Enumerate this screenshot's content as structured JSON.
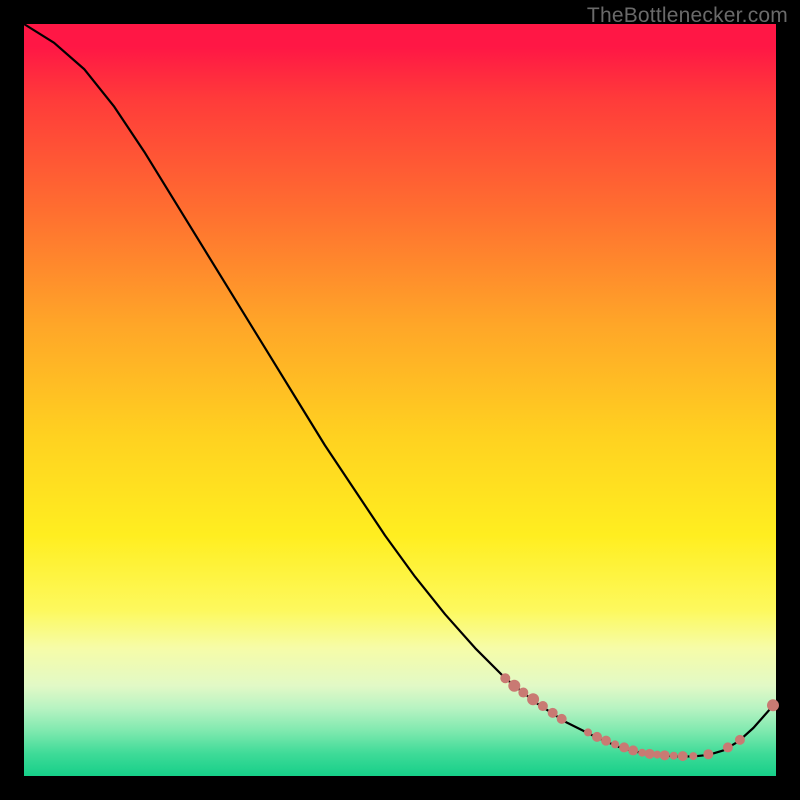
{
  "watermark": "TheBottlenecker.com",
  "colors": {
    "page_bg": "#000000",
    "curve_stroke": "#000000",
    "marker_fill": "#c97a73",
    "marker_stroke": "#c97a73"
  },
  "chart_data": {
    "type": "line",
    "title": "",
    "xlabel": "",
    "ylabel": "",
    "xlim": [
      0,
      100
    ],
    "ylim": [
      0,
      100
    ],
    "grid": false,
    "legend": false,
    "series": [
      {
        "name": "curve",
        "x": [
          0,
          4,
          8,
          12,
          16,
          20,
          24,
          28,
          32,
          36,
          40,
          44,
          48,
          52,
          56,
          60,
          64,
          68,
          72,
          76,
          79,
          81,
          83,
          85,
          87,
          89,
          91,
          93,
          95,
          97,
          100
        ],
        "y": [
          100,
          97.5,
          94,
          89,
          83,
          76.5,
          70,
          63.5,
          57,
          50.5,
          44,
          38,
          32,
          26.5,
          21.5,
          17,
          13,
          9.8,
          7.2,
          5.2,
          3.9,
          3.3,
          2.9,
          2.7,
          2.6,
          2.6,
          2.8,
          3.4,
          4.6,
          6.4,
          9.8
        ]
      }
    ],
    "markers": [
      {
        "x": 64.0,
        "y": 13.0,
        "r": 5
      },
      {
        "x": 65.2,
        "y": 12.0,
        "r": 6
      },
      {
        "x": 66.4,
        "y": 11.1,
        "r": 5
      },
      {
        "x": 67.7,
        "y": 10.2,
        "r": 6
      },
      {
        "x": 69.0,
        "y": 9.3,
        "r": 5
      },
      {
        "x": 70.3,
        "y": 8.4,
        "r": 5
      },
      {
        "x": 71.5,
        "y": 7.6,
        "r": 5
      },
      {
        "x": 75.0,
        "y": 5.8,
        "r": 4
      },
      {
        "x": 76.2,
        "y": 5.2,
        "r": 5
      },
      {
        "x": 77.4,
        "y": 4.7,
        "r": 5
      },
      {
        "x": 78.6,
        "y": 4.2,
        "r": 4
      },
      {
        "x": 79.8,
        "y": 3.8,
        "r": 5
      },
      {
        "x": 81.0,
        "y": 3.4,
        "r": 5
      },
      {
        "x": 82.2,
        "y": 3.1,
        "r": 4
      },
      {
        "x": 83.2,
        "y": 2.95,
        "r": 5
      },
      {
        "x": 84.2,
        "y": 2.85,
        "r": 4
      },
      {
        "x": 85.2,
        "y": 2.75,
        "r": 5
      },
      {
        "x": 86.4,
        "y": 2.7,
        "r": 4
      },
      {
        "x": 87.6,
        "y": 2.65,
        "r": 5
      },
      {
        "x": 89.0,
        "y": 2.65,
        "r": 4
      },
      {
        "x": 91.0,
        "y": 2.9,
        "r": 5
      },
      {
        "x": 93.6,
        "y": 3.8,
        "r": 5
      },
      {
        "x": 95.2,
        "y": 4.8,
        "r": 5
      },
      {
        "x": 99.6,
        "y": 9.4,
        "r": 6
      }
    ]
  }
}
